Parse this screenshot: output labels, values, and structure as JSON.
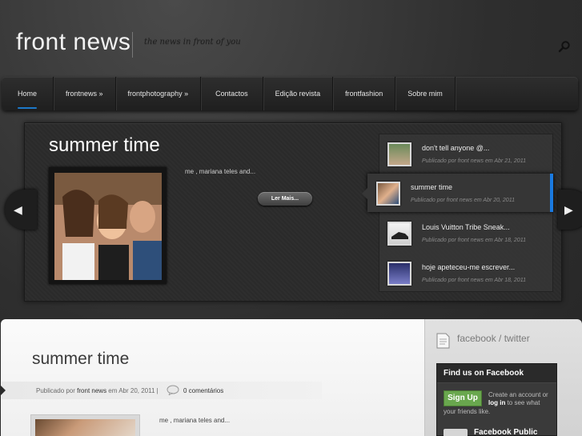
{
  "header": {
    "logo": "front news",
    "tagline": "the news in front of you"
  },
  "nav": {
    "items": [
      {
        "label": "Home",
        "active": true
      },
      {
        "label": "frontnews »"
      },
      {
        "label": "frontphotography »"
      },
      {
        "label": "Contactos"
      },
      {
        "label": "Edição revista"
      },
      {
        "label": "frontfashion"
      },
      {
        "label": "Sobre mim"
      }
    ]
  },
  "featured": {
    "title": "summer time",
    "excerpt": "me , mariana teles and...",
    "read_more": "Ler Mais..."
  },
  "slider_list": [
    {
      "title": "don't tell anyone @...",
      "meta": "Publicado por front news em Abr 21, 2011"
    },
    {
      "title": "summer time",
      "meta": "Publicado por front news em Abr 20, 2011",
      "active": true
    },
    {
      "title": "Louis Vuitton Tribe Sneak...",
      "meta": "Publicado por front news em Abr 18, 2011"
    },
    {
      "title": "hoje apeteceu-me escrever...",
      "meta": "Publicado por front news em Abr 18, 2011"
    }
  ],
  "post": {
    "title": "summer time",
    "meta_prefix": "Publicado por",
    "author": "front news",
    "meta_date": "em Abr 20, 2011 |",
    "comments": "0 comentários",
    "excerpt": "me , mariana teles and..."
  },
  "sidebar": {
    "title": "facebook / twitter",
    "fb_header": "Find us on Facebook",
    "signup": "Sign Up",
    "create_text_1": "Create an account or",
    "log_in": "log in",
    "create_text_2": "to see what",
    "create_text_3": "your friends like.",
    "page_name": "Facebook Public"
  },
  "colors": {
    "accent": "#1a7ae0",
    "fb_green": "#69a74e"
  }
}
